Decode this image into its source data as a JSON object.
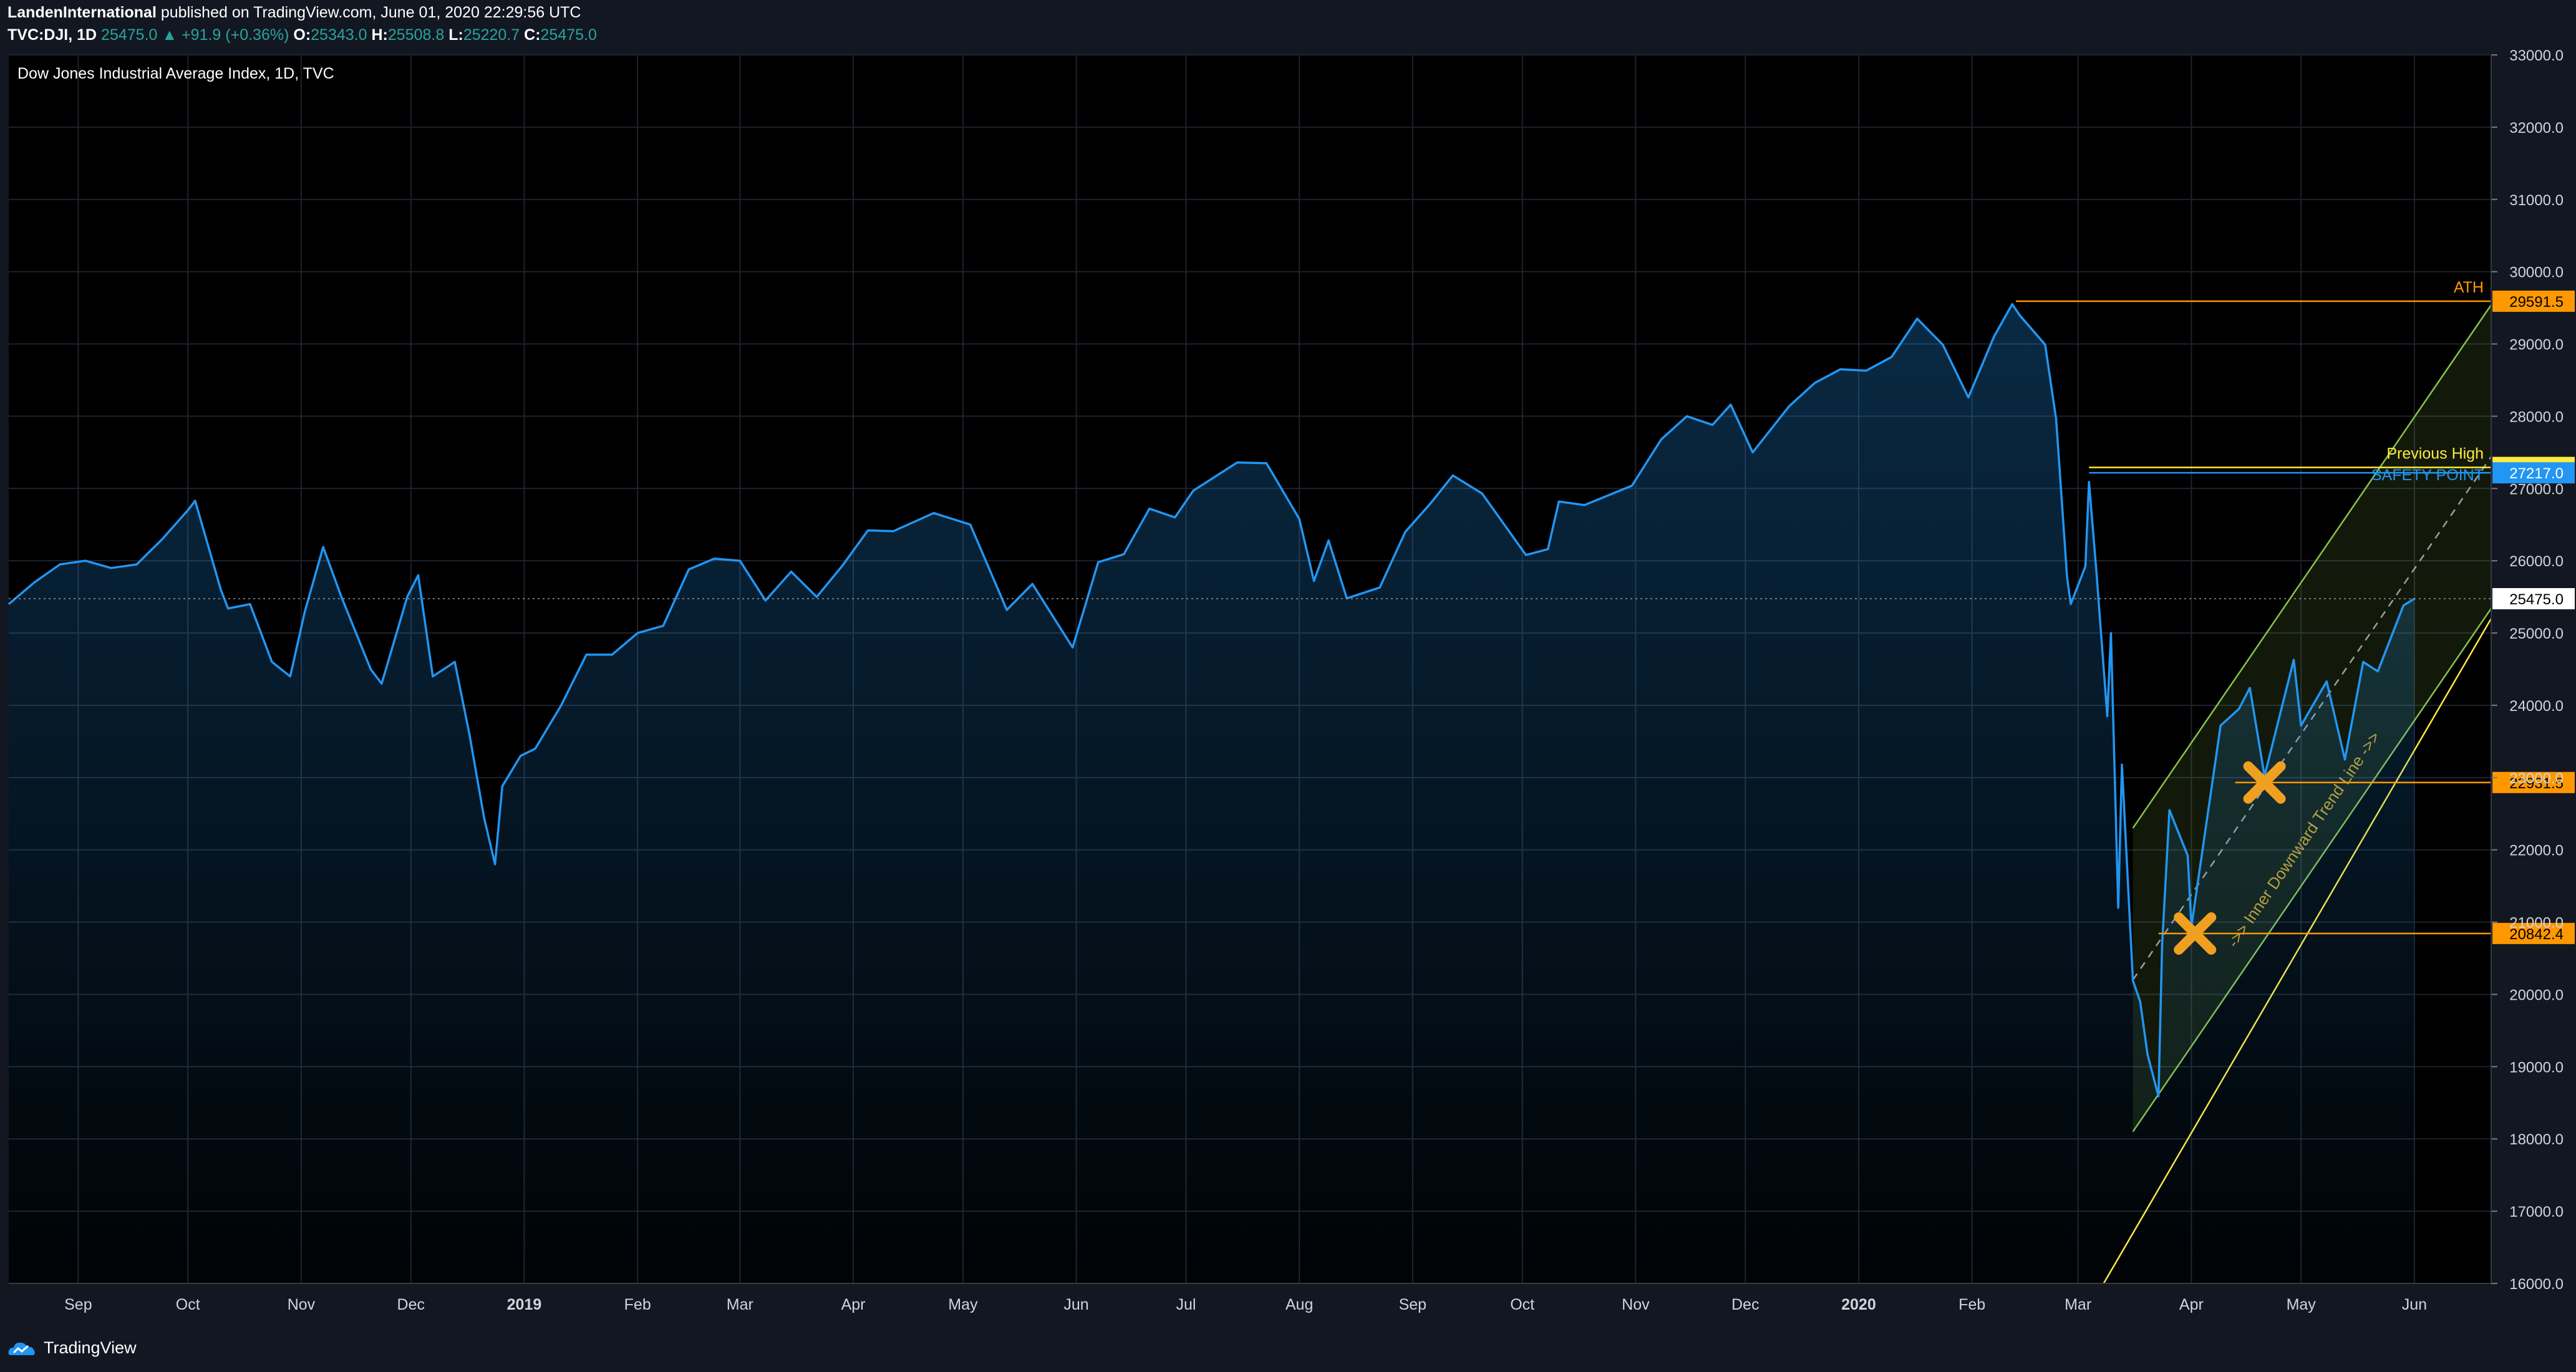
{
  "header": {
    "author": "LandenInternational",
    "published_text": "published on TradingView.com, June 01, 2020 22:29:56 UTC",
    "symbol": "TVC:DJI, 1D",
    "last": "25475.0",
    "change": "+91.9 (+0.36%)",
    "o_label": "O:",
    "o_value": "25343.0",
    "h_label": "H:",
    "h_value": "25508.8",
    "l_label": "L:",
    "l_value": "25220.7",
    "c_label": "C:",
    "c_value": "25475.0"
  },
  "footer": {
    "brand": "TradingView"
  },
  "colors": {
    "background": "#131722",
    "plot_background": "#000000",
    "line": "#2196f3",
    "grid": "#1e222d",
    "orange": "#ff9800",
    "yellow": "#ffeb3b",
    "channel": "#8bc34a",
    "header_value": "#26a69a"
  },
  "chart_data": {
    "type": "area",
    "title": "Dow Jones Industrial Average Index, 1D, TVC",
    "x_axis_ticks": [
      "Sep",
      "Oct",
      "Nov",
      "Dec",
      "2019",
      "Feb",
      "Mar",
      "Apr",
      "May",
      "Jun",
      "Jul",
      "Aug",
      "Sep",
      "Oct",
      "Nov",
      "Dec",
      "2020",
      "Feb",
      "Mar",
      "Apr",
      "May",
      "Jun"
    ],
    "y_axis_ticks": [
      "33000.0",
      "32000.0",
      "31000.0",
      "30000.0",
      "29000.0",
      "28000.0",
      "27000.0",
      "26000.0",
      "25000.0",
      "24000.0",
      "23000.0",
      "22000.0",
      "21000.0",
      "20000.0",
      "19000.0",
      "18000.0",
      "17000.0",
      "16000.0"
    ],
    "ylim": [
      16000,
      33000
    ],
    "xlim": [
      "2018-08-13",
      "2020-06-22"
    ],
    "grid": true,
    "series": [
      {
        "type": "line",
        "points": [
          [
            "2018-08-13",
            25400
          ],
          [
            "2018-08-20",
            25700
          ],
          [
            "2018-08-27",
            25950
          ],
          [
            "2018-09-03",
            26000
          ],
          [
            "2018-09-10",
            25900
          ],
          [
            "2018-09-17",
            25950
          ],
          [
            "2018-09-24",
            26300
          ],
          [
            "2018-10-01",
            26700
          ],
          [
            "2018-10-03",
            26830
          ],
          [
            "2018-10-10",
            25600
          ],
          [
            "2018-10-12",
            25340
          ],
          [
            "2018-10-18",
            25400
          ],
          [
            "2018-10-24",
            24600
          ],
          [
            "2018-10-29",
            24400
          ],
          [
            "2018-11-02",
            25300
          ],
          [
            "2018-11-07",
            26190
          ],
          [
            "2018-11-12",
            25500
          ],
          [
            "2018-11-20",
            24500
          ],
          [
            "2018-11-23",
            24300
          ],
          [
            "2018-11-30",
            25500
          ],
          [
            "2018-12-03",
            25800
          ],
          [
            "2018-12-07",
            24400
          ],
          [
            "2018-12-13",
            24600
          ],
          [
            "2018-12-17",
            23600
          ],
          [
            "2018-12-21",
            22450
          ],
          [
            "2018-12-24",
            21800
          ],
          [
            "2018-12-26",
            22880
          ],
          [
            "2018-12-31",
            23300
          ],
          [
            "2019-01-04",
            23400
          ],
          [
            "2019-01-11",
            23990
          ],
          [
            "2019-01-18",
            24700
          ],
          [
            "2019-01-25",
            24700
          ],
          [
            "2019-02-01",
            25000
          ],
          [
            "2019-02-08",
            25100
          ],
          [
            "2019-02-15",
            25880
          ],
          [
            "2019-02-22",
            26030
          ],
          [
            "2019-03-01",
            26000
          ],
          [
            "2019-03-08",
            25450
          ],
          [
            "2019-03-15",
            25850
          ],
          [
            "2019-03-22",
            25500
          ],
          [
            "2019-03-29",
            25930
          ],
          [
            "2019-04-05",
            26420
          ],
          [
            "2019-04-12",
            26410
          ],
          [
            "2019-04-23",
            26660
          ],
          [
            "2019-05-03",
            26500
          ],
          [
            "2019-05-13",
            25320
          ],
          [
            "2019-05-20",
            25680
          ],
          [
            "2019-05-31",
            24800
          ],
          [
            "2019-06-07",
            25980
          ],
          [
            "2019-06-14",
            26090
          ],
          [
            "2019-06-21",
            26720
          ],
          [
            "2019-06-28",
            26600
          ],
          [
            "2019-07-03",
            26970
          ],
          [
            "2019-07-15",
            27360
          ],
          [
            "2019-07-23",
            27350
          ],
          [
            "2019-08-01",
            26580
          ],
          [
            "2019-08-05",
            25720
          ],
          [
            "2019-08-09",
            26280
          ],
          [
            "2019-08-14",
            25480
          ],
          [
            "2019-08-23",
            25630
          ],
          [
            "2019-08-30",
            26400
          ],
          [
            "2019-09-06",
            26800
          ],
          [
            "2019-09-12",
            27180
          ],
          [
            "2019-09-20",
            26930
          ],
          [
            "2019-10-02",
            26080
          ],
          [
            "2019-10-08",
            26160
          ],
          [
            "2019-10-11",
            26820
          ],
          [
            "2019-10-18",
            26770
          ],
          [
            "2019-10-31",
            27040
          ],
          [
            "2019-11-08",
            27680
          ],
          [
            "2019-11-15",
            28000
          ],
          [
            "2019-11-22",
            27880
          ],
          [
            "2019-11-27",
            28160
          ],
          [
            "2019-12-03",
            27500
          ],
          [
            "2019-12-13",
            28140
          ],
          [
            "2019-12-20",
            28460
          ],
          [
            "2019-12-27",
            28650
          ],
          [
            "2020-01-03",
            28630
          ],
          [
            "2020-01-10",
            28820
          ],
          [
            "2020-01-17",
            29350
          ],
          [
            "2020-01-24",
            28990
          ],
          [
            "2020-01-31",
            28260
          ],
          [
            "2020-02-07",
            29100
          ],
          [
            "2020-02-12",
            29551
          ],
          [
            "2020-02-14",
            29400
          ],
          [
            "2020-02-21",
            28990
          ],
          [
            "2020-02-24",
            27960
          ],
          [
            "2020-02-27",
            25770
          ],
          [
            "2020-02-28",
            25400
          ],
          [
            "2020-03-03",
            25920
          ],
          [
            "2020-03-04",
            27090
          ],
          [
            "2020-03-06",
            25860
          ],
          [
            "2020-03-09",
            23850
          ],
          [
            "2020-03-10",
            25000
          ],
          [
            "2020-03-12",
            21200
          ],
          [
            "2020-03-13",
            23180
          ],
          [
            "2020-03-16",
            20190
          ],
          [
            "2020-03-18",
            19900
          ],
          [
            "2020-03-20",
            19170
          ],
          [
            "2020-03-23",
            18590
          ],
          [
            "2020-03-24",
            20700
          ],
          [
            "2020-03-26",
            22550
          ],
          [
            "2020-03-31",
            21920
          ],
          [
            "2020-04-01",
            20940
          ],
          [
            "2020-04-06",
            22680
          ],
          [
            "2020-04-09",
            23720
          ],
          [
            "2020-04-14",
            23950
          ],
          [
            "2020-04-17",
            24240
          ],
          [
            "2020-04-21",
            23020
          ],
          [
            "2020-04-29",
            24630
          ],
          [
            "2020-05-01",
            23720
          ],
          [
            "2020-05-08",
            24330
          ],
          [
            "2020-05-13",
            23250
          ],
          [
            "2020-05-18",
            24600
          ],
          [
            "2020-05-22",
            24470
          ],
          [
            "2020-05-26",
            24990
          ],
          [
            "2020-05-29",
            25380
          ],
          [
            "2020-06-01",
            25475
          ]
        ]
      }
    ],
    "horizontal_levels": [
      {
        "label": "ATH",
        "value": "29591.5",
        "level": 29591.5,
        "color": "#ff9800",
        "x_start": "2020-02-13"
      },
      {
        "label": "Previous High",
        "value": "27291.1",
        "level": 27291.1,
        "color": "#ffeb3b",
        "x_start": "2020-03-04"
      },
      {
        "label": "SAFETY POINT",
        "value": "27217.0",
        "level": 27217.0,
        "color": "#2196f3",
        "x_start": "2020-03-04"
      },
      {
        "label": "",
        "value": "25475.0",
        "level": 25475.0,
        "color": "#ffffff",
        "x_start": "2018-08-13"
      },
      {
        "label": "",
        "value": "22931.5",
        "level": 22931.5,
        "color": "#ff9800",
        "x_start": "2020-04-13"
      },
      {
        "label": "",
        "value": "20842.4",
        "level": 20842.4,
        "color": "#ff9800",
        "x_start": "2020-03-23"
      }
    ],
    "channel": {
      "upper": [
        [
          "2020-03-16",
          22300
        ],
        [
          "2020-06-22",
          29540
        ]
      ],
      "lower": [
        [
          "2020-03-16",
          18100
        ],
        [
          "2020-06-22",
          25340
        ]
      ],
      "mid": [
        [
          "2020-03-16",
          20200
        ],
        [
          "2020-06-22",
          27440
        ]
      ]
    },
    "trend_line": {
      "from": [
        "2020-03-08",
        16000
      ],
      "to": [
        "2020-06-22",
        25200
      ]
    },
    "trend_label": "->> Inner Downward Trend Line ->>",
    "markers": [
      {
        "x": "2020-04-02",
        "y": 20842.4
      },
      {
        "x": "2020-04-21",
        "y": 22931.5
      }
    ]
  }
}
